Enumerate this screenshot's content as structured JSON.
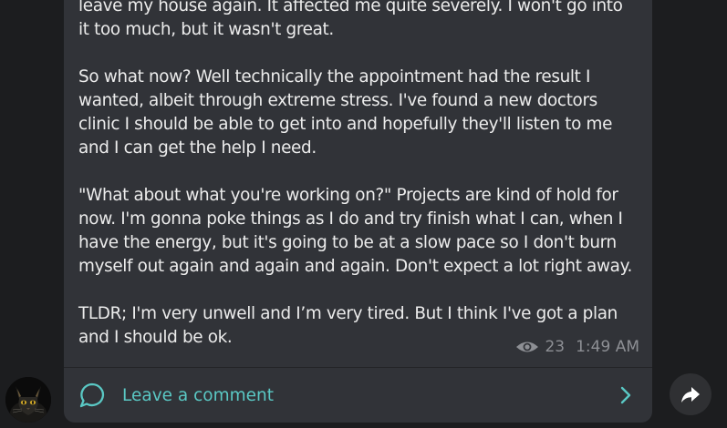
{
  "post": {
    "paragraphs": [
      [
        "leave my house again. It affected me quite severely. I won't go into",
        "it too much, but it wasn't great."
      ],
      [
        "So what now? Well technically the appointment had the result I",
        "wanted, albeit through extreme stress. I've found a new doctors",
        "clinic I should be able to get into and hopefully they'll listen to me",
        "and I can get the help I need."
      ],
      [
        "\"What about what you're working on?\" Projects are kind of hold for",
        "now. I'm gonna poke things as I do and try finish what I can, when I",
        "have the energy, but it's going to be at a slow pace so I don't burn",
        "myself out again and again and again. Don't expect a lot right away."
      ],
      [
        "TLDR; I'm very unwell and I’m very tired. But I think I've got a plan",
        "and I should be ok."
      ]
    ],
    "views": "23",
    "time": "1:49 AM"
  },
  "comments": {
    "label": "Leave a comment"
  },
  "icons": {
    "views": "eye-icon",
    "comment": "comment-bubble-icon",
    "chevron": "chevron-right-icon",
    "share": "share-arrow-icon",
    "avatar": "cat-avatar"
  },
  "colors": {
    "background": "#1c1d1f",
    "bubble": "#313338",
    "text": "#ececec",
    "meta": "#8d8f94",
    "accent": "#5ac8c4"
  }
}
